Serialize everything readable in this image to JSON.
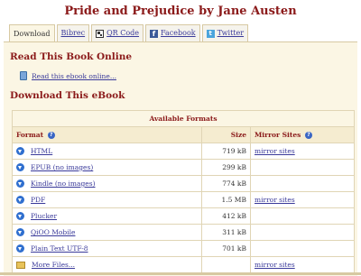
{
  "page": {
    "title": "Pride and Prejudice by Jane Austen"
  },
  "tabs": [
    {
      "label": "Download"
    },
    {
      "label": "Bibrec"
    },
    {
      "label": "QR Code",
      "icon": "qr-code-icon"
    },
    {
      "label": "Facebook",
      "icon": "facebook-icon"
    },
    {
      "label": "Twitter",
      "icon": "twitter-icon"
    }
  ],
  "read_online": {
    "heading": "Read This Book Online",
    "link": "Read this ebook online..."
  },
  "download": {
    "heading": "Download This eBook",
    "caption": "Available Formats",
    "headers": {
      "format": "Format",
      "size": "Size",
      "mirror": "Mirror Sites"
    },
    "rows": [
      {
        "format": "HTML",
        "size": "719 kB",
        "mirror": "mirror sites"
      },
      {
        "format": "EPUB (no images)",
        "size": "299 kB",
        "mirror": ""
      },
      {
        "format": "Kindle (no images)",
        "size": "774 kB",
        "mirror": ""
      },
      {
        "format": "PDF",
        "size": "1.5 MB",
        "mirror": "mirror sites"
      },
      {
        "format": "Plucker",
        "size": "412 kB",
        "mirror": ""
      },
      {
        "format": "QiOO Mobile",
        "size": "311 kB",
        "mirror": ""
      },
      {
        "format": "Plain Text UTF-8",
        "size": "701 kB",
        "mirror": ""
      },
      {
        "format": "More Files...",
        "size": "",
        "mirror": "mirror sites"
      }
    ]
  },
  "colors": {
    "accent": "#8b1a1a",
    "panel": "#fbf6e4",
    "link": "#3a3a9a"
  }
}
